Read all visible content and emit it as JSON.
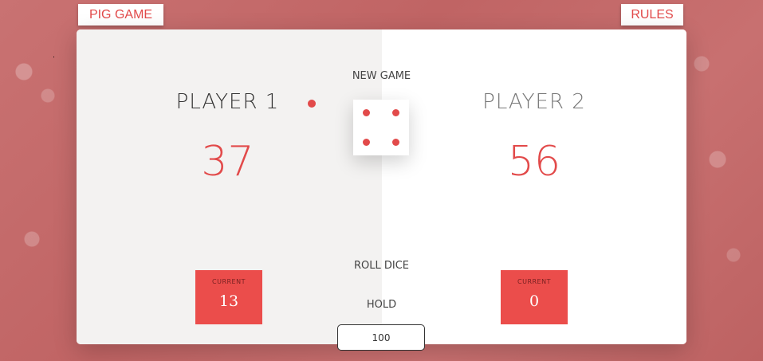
{
  "header": {
    "title_label": "PIG GAME",
    "rules_label": "RULES"
  },
  "players": [
    {
      "name": "PLAYER 1",
      "score": "37",
      "current_label": "CURRENT",
      "current_value": "13",
      "active": true
    },
    {
      "name": "PLAYER 2",
      "score": "56",
      "current_label": "CURRENT",
      "current_value": "0",
      "active": false
    }
  ],
  "controls": {
    "new_game_label": "NEW GAME",
    "roll_dice_label": "ROLL DICE",
    "hold_label": "HOLD",
    "target_score_value": "100"
  },
  "dice": {
    "face": 4
  },
  "colors": {
    "accent": "#eb4d4b",
    "left_panel": "#f3f2f1",
    "right_panel": "#ffffff",
    "background": "#c86a6a"
  }
}
